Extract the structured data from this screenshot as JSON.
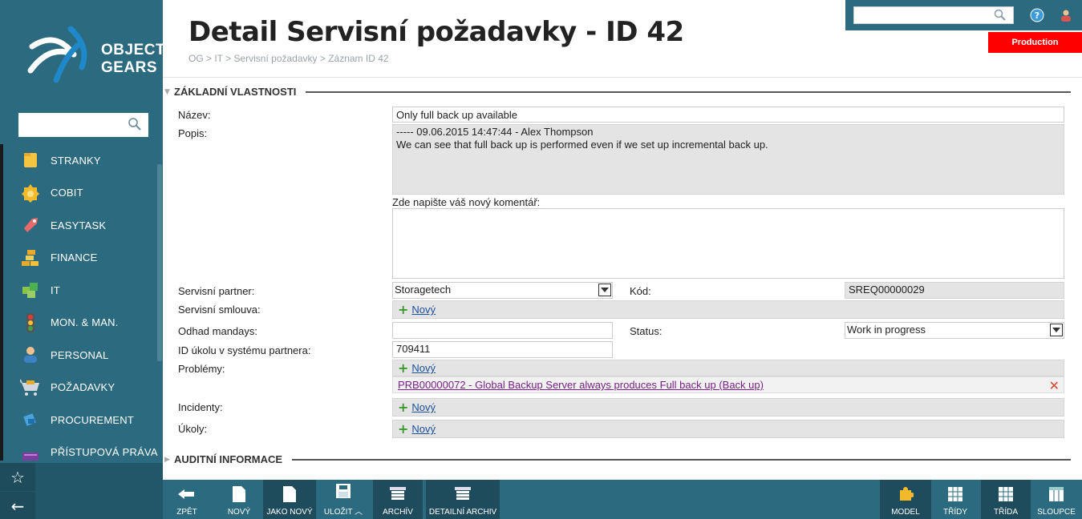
{
  "brand": {
    "line1": "OBJECT",
    "line2": "GEARS"
  },
  "sidebar": {
    "search_placeholder": "",
    "items": [
      {
        "label": "STRANKY",
        "icon": "folder-icon"
      },
      {
        "label": "COBIT",
        "icon": "badge-icon"
      },
      {
        "label": "EASYTASK",
        "icon": "tag-icon"
      },
      {
        "label": "FINANCE",
        "icon": "coins-icon"
      },
      {
        "label": "IT",
        "icon": "cubes-icon"
      },
      {
        "label": "MON. & MAN.",
        "icon": "traffic-light-icon"
      },
      {
        "label": "PERSONAL",
        "icon": "person-icon"
      },
      {
        "label": "POŽADAVKY",
        "icon": "cart-icon"
      },
      {
        "label": "PROCUREMENT",
        "icon": "procurement-icon"
      },
      {
        "label": "PŘÍSTUPOVÁ PRÁVA",
        "icon": "access-icon"
      }
    ]
  },
  "header": {
    "title": "Detail Servisní požadavky - ID 42",
    "breadcrumb": "OG > IT > Servisní požadavky > Záznam ID 42",
    "environment": "Production"
  },
  "sections": {
    "basic": "ZÁKLADNÍ VLASTNOSTI",
    "audit": "AUDITNÍ INFORMACE"
  },
  "form": {
    "name_label": "Název:",
    "name_value": "Only full back up available",
    "desc_label": "Popis:",
    "desc_line1": "----- 09.06.2015 14:47:44 - Alex Thompson",
    "desc_line2": "We can see that full back up is performed even if we set up incremental back up.",
    "comment_label": "Zde napište váš nový komentář:",
    "partner_label": "Servisní partner:",
    "partner_value": "Storagetech",
    "code_label": "Kód:",
    "code_value": "SREQ00000029",
    "contract_label": "Servisní smlouva:",
    "mandays_label": "Odhad mandays:",
    "mandays_value": "",
    "status_label": "Status:",
    "status_value": "Work in progress",
    "task_id_label": "ID úkolu v systému partnera:",
    "task_id_value": "709411",
    "problems_label": "Problémy:",
    "problem_link": "PRB00000072 - Global Backup Server always produces Full back up (Back up)",
    "incidents_label": "Incidenty:",
    "tasks_label": "Úkoly:",
    "new_label": "Nový"
  },
  "toolbar": {
    "back": "ZPĚT",
    "new": "NOVÝ",
    "as_new": "JAKO NOVÝ",
    "save": "ULOŽIT",
    "archive": "ARCHÍV",
    "detail_archive": "DETAILNÍ ARCHIV",
    "model": "MODEL",
    "classes": "TŘÍDY",
    "class": "TŘÍDA",
    "columns": "SLOUPCE"
  },
  "colors": {
    "primary": "#2c6a80",
    "dark": "#1f4c5d",
    "badge": "#ff0000"
  }
}
